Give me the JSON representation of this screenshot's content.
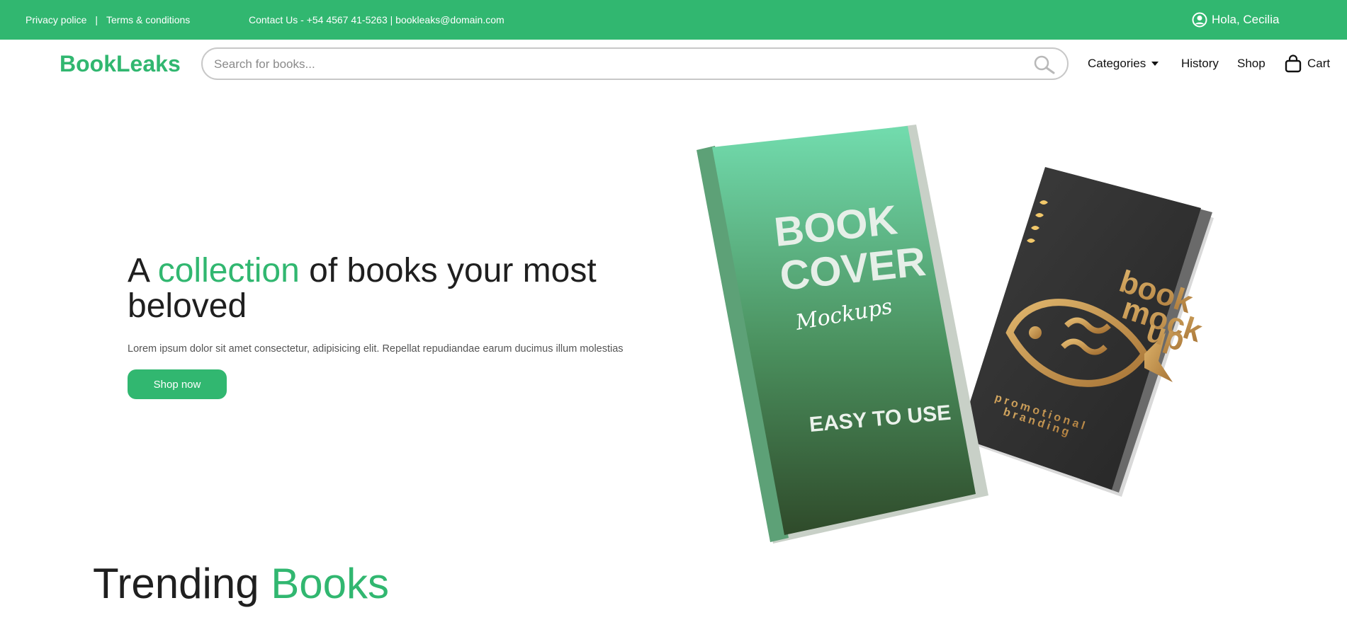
{
  "topbar": {
    "privacy": "Privacy police",
    "separator": "|",
    "terms": "Terms & conditions",
    "contact": "Contact Us - +54 4567 41-5263 | bookleaks@domain.com",
    "user_greeting": "Hola, Cecilia",
    "user_icon": "user-circle-icon"
  },
  "header": {
    "logo": "BookLeaks",
    "search_placeholder": "Search for books...",
    "search_icon": "search-icon",
    "nav": {
      "categories": "Categories",
      "history": "History",
      "shop": "Shop",
      "cart": "Cart"
    }
  },
  "hero": {
    "title_part1": "A ",
    "title_accent": "collection",
    "title_part2": " of books your most beloved",
    "description": "Lorem ipsum dolor sit amet consectetur, adipisicing elit. Repellat repudiandae earum ducimus illum molestias",
    "button": "Shop now",
    "book1": {
      "line1": "BOOK",
      "line2": "COVER",
      "script": "Mockups",
      "bottom": "EASY TO USE"
    },
    "book2": {
      "line1": "book",
      "line2": "mock",
      "line3": "up",
      "bottom1": "promotional",
      "bottom2": "branding"
    }
  },
  "trending": {
    "title_part1": "Trending ",
    "title_accent": "Books"
  },
  "colors": {
    "brand": "#31b770",
    "text": "#1f1f1f"
  }
}
